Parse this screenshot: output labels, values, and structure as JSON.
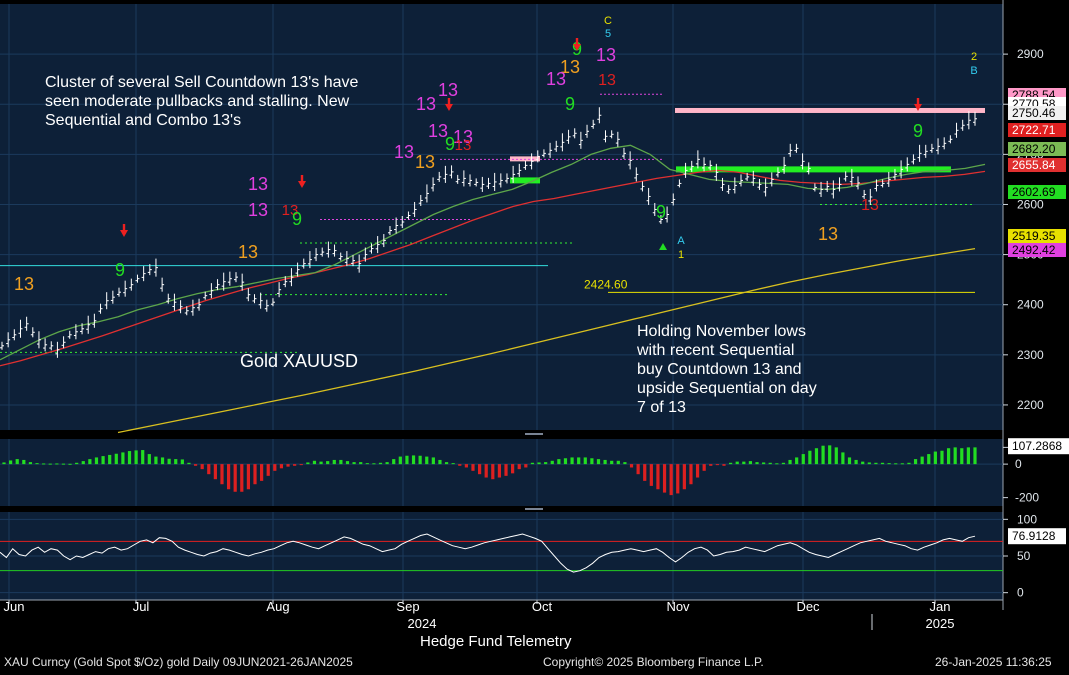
{
  "chart_data": [
    {
      "type": "line",
      "panel": "price",
      "title": "Gold XAUUSD",
      "security": "XAU Curncy (Gold Spot  $/Oz) gold  Daily 09JUN2021-26JAN2025",
      "ylim": [
        2150,
        3000
      ],
      "y_ticks": [
        2200,
        2300,
        2400,
        2500,
        2600,
        2700,
        2800,
        2900
      ],
      "x_labels": [
        "Jun",
        "Jul",
        "Aug",
        "Sep",
        "Oct",
        "Nov",
        "Dec",
        "Jan"
      ],
      "year_labels": [
        "2024",
        "2025"
      ],
      "series": [
        {
          "name": "Price",
          "color": "#ffffff",
          "values": [
            2318,
            2330,
            2340,
            2352,
            2362,
            2345,
            2330,
            2320,
            2318,
            2310,
            2325,
            2340,
            2346,
            2352,
            2360,
            2368,
            2392,
            2408,
            2415,
            2425,
            2432,
            2440,
            2452,
            2462,
            2470,
            2474,
            2440,
            2412,
            2405,
            2396,
            2388,
            2394,
            2400,
            2418,
            2428,
            2440,
            2446,
            2452,
            2455,
            2445,
            2420,
            2412,
            2408,
            2398,
            2405,
            2430,
            2446,
            2455,
            2470,
            2482,
            2490,
            2500,
            2505,
            2510,
            2508,
            2496,
            2492,
            2488,
            2482,
            2500,
            2512,
            2520,
            2528,
            2548,
            2558,
            2565,
            2578,
            2590,
            2608,
            2622,
            2640,
            2655,
            2660,
            2665,
            2650,
            2652,
            2648,
            2644,
            2640,
            2642,
            2645,
            2648,
            2652,
            2660,
            2668,
            2678,
            2686,
            2696,
            2702,
            2708,
            2716,
            2724,
            2735,
            2742,
            2728,
            2746,
            2760,
            2778,
            2736,
            2740,
            2730,
            2702,
            2688,
            2660,
            2636,
            2616,
            2590,
            2570,
            2580,
            2610,
            2642,
            2668,
            2676,
            2690,
            2680,
            2678,
            2664,
            2640,
            2630,
            2638,
            2648,
            2655,
            2652,
            2640,
            2634,
            2650,
            2664,
            2678,
            2708,
            2712,
            2686,
            2672,
            2634,
            2630,
            2636,
            2630,
            2640,
            2656,
            2654,
            2643,
            2620,
            2615,
            2638,
            2642,
            2650,
            2660,
            2670,
            2680,
            2690,
            2702,
            2706,
            2712,
            2716,
            2722,
            2730,
            2748,
            2758,
            2768,
            2771
          ]
        },
        {
          "name": "Moving average (red)",
          "color": "#e03030",
          "values": [
            2278,
            2288,
            2300,
            2312,
            2325,
            2338,
            2352,
            2366,
            2380,
            2394,
            2408,
            2420,
            2432,
            2442,
            2452,
            2460,
            2470,
            2480,
            2492,
            2506,
            2520,
            2536,
            2552,
            2568,
            2582,
            2596,
            2606,
            2612,
            2620,
            2628,
            2636,
            2644,
            2652,
            2658,
            2664,
            2668,
            2664,
            2656,
            2648,
            2644,
            2642,
            2640,
            2642,
            2646,
            2650,
            2654,
            2656,
            2660,
            2666
          ]
        },
        {
          "name": "Moving average (green)",
          "color": "#5da64a",
          "values": [
            2290,
            2310,
            2330,
            2346,
            2358,
            2366,
            2376,
            2390,
            2400,
            2412,
            2422,
            2430,
            2436,
            2444,
            2452,
            2458,
            2464,
            2480,
            2500,
            2520,
            2540,
            2560,
            2580,
            2596,
            2610,
            2620,
            2630,
            2646,
            2664,
            2680,
            2700,
            2712,
            2718,
            2700,
            2670,
            2660,
            2650,
            2646,
            2644,
            2642,
            2640,
            2632,
            2630,
            2634,
            2642,
            2652,
            2660,
            2666,
            2668,
            2672,
            2680
          ]
        },
        {
          "name": "Moving average (yellow)",
          "color": "#d8c020",
          "values": [
            2145,
            2160,
            2175,
            2190,
            2205,
            2220,
            2236,
            2252,
            2268,
            2285,
            2302,
            2320,
            2338,
            2356,
            2374,
            2392,
            2410,
            2428,
            2445,
            2460,
            2474,
            2488,
            2500,
            2512
          ]
        }
      ],
      "price_labels": [
        {
          "value": 2788.54,
          "text": "2788.54",
          "color": "#ff99c8"
        },
        {
          "value": 2770.58,
          "text": "2770.58",
          "color": "#ffffff"
        },
        {
          "value": 2750.46,
          "text": "2750.46",
          "color": "#f0f0f0"
        },
        {
          "value": 2722.71,
          "text": "2722.71",
          "color": "#e02020"
        },
        {
          "value": 2682.2,
          "text": "2682.20",
          "color": "#7cbb55"
        },
        {
          "value": 2655.84,
          "text": "2655.84",
          "color": "#e03030"
        },
        {
          "value": 2602.69,
          "text": "2602.69",
          "color": "#22dd22"
        },
        {
          "value": 2519.35,
          "text": "2519.35",
          "color": "#e8e000"
        },
        {
          "value": 2492.42,
          "text": "2492.42",
          "color": "#e040e0"
        }
      ],
      "level_lines": [
        {
          "text": "2424.60",
          "value": 2424.6
        },
        {
          "text": "",
          "value": 2788.54
        }
      ],
      "annotations": [
        {
          "text": "13",
          "color": "#f0a020"
        },
        {
          "text": "13",
          "color": "#e040e0"
        },
        {
          "text": "13",
          "color": "#e02020"
        },
        {
          "text": "9",
          "color": "#22dd22"
        },
        {
          "text": "C",
          "color": "#e8e000"
        },
        {
          "text": "5",
          "color": "#33ccee"
        },
        {
          "text": "2",
          "color": "#e8e000"
        },
        {
          "text": "B",
          "color": "#33ccee"
        },
        {
          "text": "A",
          "color": "#33ccee"
        },
        {
          "text": "1",
          "color": "#e8e000"
        }
      ]
    },
    {
      "type": "bar",
      "panel": "oscillator",
      "ylim": [
        -250,
        150
      ],
      "y_ticks": [
        100,
        0,
        -200
      ],
      "last_value": "107.2868",
      "values": [
        10,
        22,
        30,
        25,
        12,
        6,
        4,
        3,
        4,
        3,
        2,
        8,
        18,
        30,
        40,
        48,
        55,
        62,
        70,
        78,
        82,
        84,
        60,
        45,
        40,
        32,
        30,
        28,
        8,
        -10,
        -30,
        -60,
        -90,
        -120,
        -150,
        -165,
        -165,
        -150,
        -120,
        -100,
        -70,
        -40,
        -25,
        -15,
        -10,
        -5,
        10,
        20,
        15,
        18,
        25,
        25,
        18,
        12,
        12,
        6,
        5,
        8,
        12,
        30,
        45,
        50,
        52,
        50,
        45,
        40,
        25,
        12,
        6,
        -10,
        -20,
        -40,
        -60,
        -80,
        -90,
        -80,
        -70,
        -55,
        -30,
        -20,
        8,
        10,
        12,
        20,
        30,
        35,
        40,
        40,
        40,
        35,
        30,
        25,
        20,
        20,
        12,
        -20,
        -60,
        -100,
        -130,
        -150,
        -170,
        -185,
        -175,
        -150,
        -120,
        -80,
        -40,
        -10,
        -5,
        -10,
        8,
        15,
        15,
        18,
        12,
        10,
        8,
        5,
        8,
        25,
        40,
        60,
        80,
        95,
        110,
        112,
        100,
        70,
        40,
        25,
        15,
        10,
        8,
        8,
        6,
        5,
        5,
        8,
        30,
        45,
        60,
        75,
        80,
        95,
        100,
        95,
        100,
        100
      ]
    },
    {
      "type": "line",
      "panel": "momentum",
      "ylim": [
        -10,
        110
      ],
      "y_ticks": [
        100,
        50,
        0
      ],
      "reference_lines": [
        {
          "value": 70,
          "color": "#e02020"
        },
        {
          "value": 30,
          "color": "#22cc22"
        }
      ],
      "last_value": "76.9128",
      "values": [
        55,
        48,
        60,
        52,
        50,
        58,
        62,
        55,
        60,
        58,
        50,
        45,
        50,
        48,
        52,
        56,
        54,
        60,
        62,
        58,
        60,
        65,
        70,
        72,
        68,
        75,
        74,
        70,
        62,
        58,
        55,
        52,
        50,
        54,
        56,
        60,
        58,
        55,
        52,
        50,
        53,
        55,
        58,
        60,
        64,
        68,
        70,
        68,
        65,
        62,
        60,
        64,
        68,
        72,
        76,
        74,
        70,
        66,
        64,
        60,
        56,
        58,
        60,
        66,
        70,
        74,
        78,
        80,
        76,
        72,
        68,
        64,
        62,
        60,
        62,
        65,
        68,
        70,
        72,
        74,
        76,
        78,
        80,
        77,
        74,
        70,
        60,
        50,
        40,
        32,
        28,
        30,
        34,
        40,
        48,
        52,
        55,
        56,
        58,
        60,
        58,
        56,
        58,
        60,
        55,
        48,
        42,
        48,
        55,
        60,
        62,
        58,
        50,
        52,
        55,
        56,
        58,
        62,
        60,
        58,
        56,
        60,
        64,
        66,
        68,
        65,
        60,
        55,
        52,
        50,
        48,
        52,
        56,
        60,
        64,
        68,
        70,
        72,
        74,
        70,
        68,
        66,
        64,
        60,
        58,
        62,
        65,
        68,
        72,
        74,
        72,
        70,
        75,
        77
      ]
    }
  ],
  "notes": {
    "top_left": "Cluster of several Sell Countdown 13's have seen moderate pullbacks and stalling.  New Sequential and Combo 13's",
    "bottom_right": "Holding November lows with recent Sequential buy Countdown 13 and upside Sequential on day 7 of 13",
    "chart_name": "Gold XAUUSD"
  },
  "footer": {
    "center": "Hedge Fund Telemetry",
    "left": "XAU Curncy (Gold Spot  $/Oz) gold  Daily 09JUN2021-26JAN2025",
    "middle": "Copyright© 2025 Bloomberg Finance L.P.",
    "right": "26-Jan-2025 11:36:25"
  },
  "colors": {
    "panel_bg": "#0d2038",
    "grid": "#1b3a5c",
    "price": "#ffffff",
    "up_bar": "#22dd22",
    "down_bar": "#dd2020"
  }
}
